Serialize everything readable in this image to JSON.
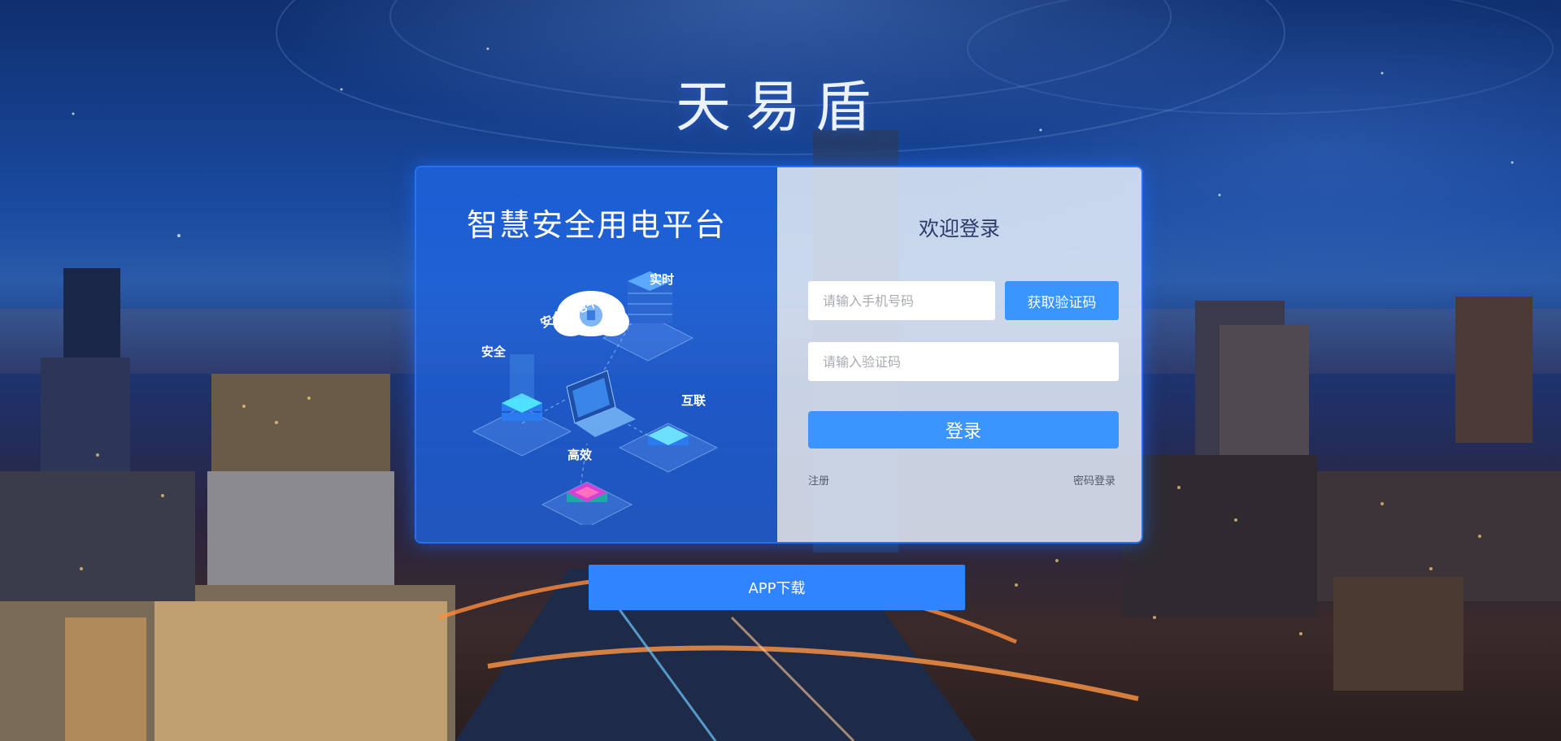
{
  "brand": {
    "title": "天易盾"
  },
  "platform": {
    "title": "智慧安全用电平台",
    "illustration": {
      "cloud_label": "安全用电平台",
      "labels": {
        "realtime": "实时",
        "safety": "安全",
        "interconnect": "互联",
        "efficient": "高效"
      }
    }
  },
  "login": {
    "welcome": "欢迎登录",
    "phone_placeholder": "请输入手机号码",
    "get_code_label": "获取验证码",
    "code_placeholder": "请输入验证码",
    "login_label": "登录",
    "register_link": "注册",
    "password_login_link": "密码登录"
  },
  "app_download": {
    "label": "APP下载"
  },
  "colors": {
    "accent": "#3a95ff",
    "app_button": "#2f85ff",
    "card_left": "#1e64e1",
    "card_border": "#2878ff"
  }
}
